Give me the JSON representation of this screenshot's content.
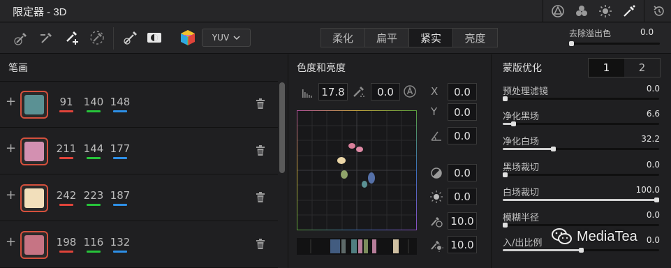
{
  "window": {
    "title": "限定器 - 3D"
  },
  "titlebar_icons": [
    "qualifier-hsl-icon",
    "qualifier-rgb-icon",
    "qualifier-luma-icon",
    "qualifier-3d-icon",
    "reset-icon"
  ],
  "toolbar": {
    "color_space": "YUV",
    "modes": [
      "柔化",
      "扁平",
      "紧实",
      "亮度"
    ],
    "active_mode": "紧实",
    "despill": {
      "label": "去除溢出色",
      "value": "0.0",
      "fraction": 0.0
    }
  },
  "strokes": {
    "heading": "笔画",
    "items": [
      {
        "color": "#5b9194",
        "r": "91",
        "g": "140",
        "b": "148"
      },
      {
        "color": "#d390b1",
        "r": "211",
        "g": "144",
        "b": "177"
      },
      {
        "color": "#f2dfbb",
        "r": "242",
        "g": "223",
        "b": "187"
      },
      {
        "color": "#c67484",
        "r": "198",
        "g": "116",
        "b": "132"
      }
    ]
  },
  "chroma": {
    "heading": "色度和亮度",
    "hue_value": "17.8",
    "soft_value": "0.0",
    "x_label": "X",
    "x_value": "0.0",
    "y_label": "Y",
    "y_value": "0.0",
    "rotate_value": "0.0",
    "f1_value": "0.0",
    "f2_value": "0.0",
    "f3_value": "10.0",
    "f4_value": "10.0"
  },
  "mask": {
    "heading": "蒙版优化",
    "tabs": [
      "1",
      "2"
    ],
    "active_tab": "1",
    "items": [
      {
        "label": "预处理滤镜",
        "value": "0.0",
        "fraction": 0.0
      },
      {
        "label": "净化黑场",
        "value": "6.6",
        "fraction": 0.066
      },
      {
        "label": "净化白场",
        "value": "32.2",
        "fraction": 0.322
      },
      {
        "label": "黑场裁切",
        "value": "0.0",
        "fraction": 0.0
      },
      {
        "label": "白场裁切",
        "value": "100.0",
        "fraction": 1.0
      },
      {
        "label": "模糊半径",
        "value": "0.0",
        "fraction": 0.0
      },
      {
        "label": "入/出比例",
        "value": "0.0",
        "fraction": 0.5
      }
    ]
  },
  "watermark": {
    "text": "MediaTea"
  },
  "colors": {
    "red": "#e0443a",
    "green": "#27c43a",
    "blue": "#2e8fe6",
    "swatch_border": "#d4503d"
  }
}
